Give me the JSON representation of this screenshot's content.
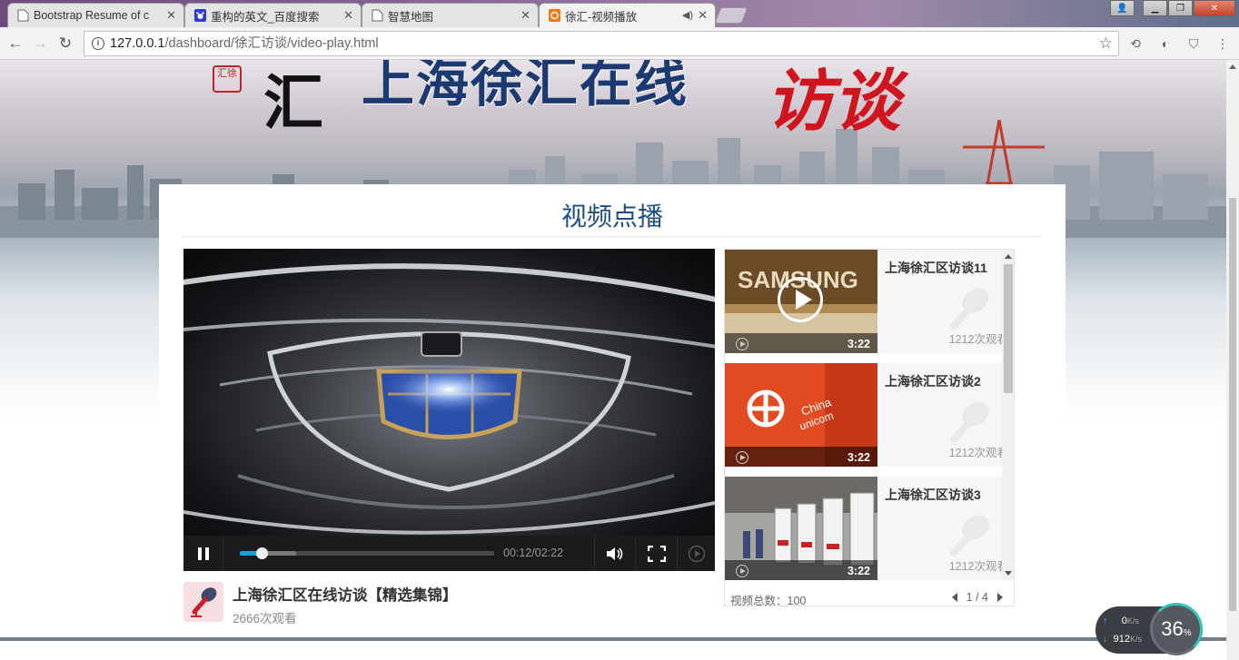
{
  "browser": {
    "tabs": [
      {
        "title": "Bootstrap Resume of c",
        "active": false
      },
      {
        "title": "重构的英文_百度搜索",
        "active": false
      },
      {
        "title": "智慧地图",
        "active": false
      },
      {
        "title": "徐汇-视频播放",
        "active": true
      }
    ],
    "url_host": "127.0.0.1",
    "url_path": "/dashboard/徐汇访谈/video-play.html"
  },
  "banner": {
    "title": "上海徐汇在线",
    "accent": "访谈",
    "seal": "汇徐"
  },
  "page": {
    "heading": "视频点播"
  },
  "player": {
    "current_time": "00:12",
    "duration": "02:22",
    "time_display": "00:12/02:22",
    "progress_fraction": 0.085,
    "buffered_fraction": 0.22,
    "accent_color": "#18a0dc"
  },
  "video": {
    "title": "上海徐汇区在线访谈【精选集锦】",
    "views": "2666次观看"
  },
  "playlist": {
    "items": [
      {
        "name": "上海徐汇区访谈11",
        "duration": "3:22",
        "views": "1212次观看",
        "thumb": "samsung"
      },
      {
        "name": "上海徐汇区访谈2",
        "duration": "3:22",
        "views": "1212次观看",
        "thumb": "unicom"
      },
      {
        "name": "上海徐汇区访谈3",
        "duration": "3:22",
        "views": "1212次观看",
        "thumb": "chargers"
      }
    ],
    "total_label": "视频总数：100",
    "page": "1 / 4"
  },
  "speed_widget": {
    "up": "0",
    "down": "912",
    "unit": "K/s",
    "percent": "36",
    "percent_sign": "%"
  }
}
